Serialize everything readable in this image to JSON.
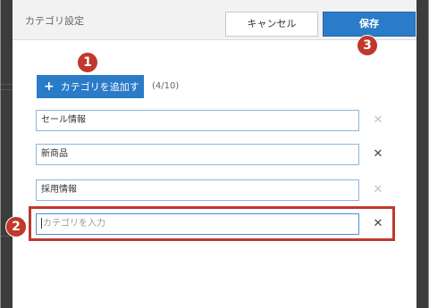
{
  "dialog": {
    "title": "カテゴリ設定"
  },
  "header": {
    "cancel_label": "キャンセル",
    "save_label": "保存"
  },
  "add_button": {
    "icon": "+",
    "label": "カテゴリを追加する"
  },
  "count": "(4/10)",
  "categories": [
    {
      "value": "セール情報",
      "delete_enabled": false
    },
    {
      "value": "新商品",
      "delete_enabled": true
    },
    {
      "value": "採用情報",
      "delete_enabled": false
    },
    {
      "value": "",
      "placeholder": "カテゴリを入力",
      "delete_enabled": true
    }
  ],
  "delete_glyph": "✕",
  "annotations": {
    "badge_1": "1",
    "badge_2": "2",
    "badge_3": "3"
  },
  "colors": {
    "primary": "#2a7bc8",
    "annotation": "#c0392b"
  }
}
